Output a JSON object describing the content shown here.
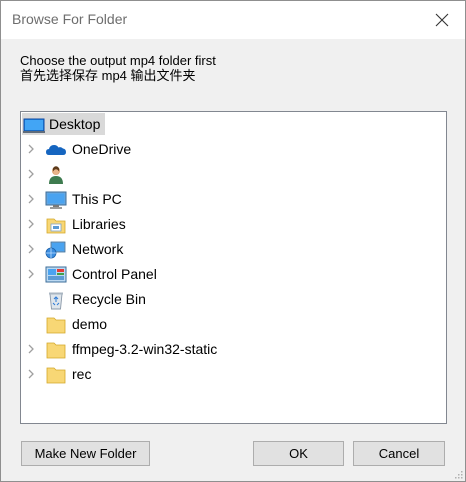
{
  "window": {
    "title": "Browse For Folder"
  },
  "instructions": {
    "line1": "Choose the output mp4 folder first",
    "line2": "首先选择保存 mp4 输出文件夹"
  },
  "tree": {
    "items": [
      {
        "label": "Desktop",
        "icon": "desktop-icon",
        "expandable": false,
        "selected": true
      },
      {
        "label": "OneDrive",
        "icon": "cloud-icon",
        "expandable": true
      },
      {
        "label": "",
        "icon": "user-icon",
        "expandable": true
      },
      {
        "label": "This PC",
        "icon": "computer-icon",
        "expandable": true
      },
      {
        "label": "Libraries",
        "icon": "libraries-icon",
        "expandable": true
      },
      {
        "label": "Network",
        "icon": "network-icon",
        "expandable": true
      },
      {
        "label": "Control Panel",
        "icon": "control-panel-icon",
        "expandable": true
      },
      {
        "label": "Recycle Bin",
        "icon": "recycle-bin-icon",
        "expandable": false
      },
      {
        "label": "demo",
        "icon": "folder-icon",
        "expandable": false
      },
      {
        "label": "ffmpeg-3.2-win32-static",
        "icon": "folder-icon",
        "expandable": true
      },
      {
        "label": "rec",
        "icon": "folder-icon",
        "expandable": true
      }
    ]
  },
  "buttons": {
    "new_folder": "Make New Folder",
    "ok": "OK",
    "cancel": "Cancel"
  },
  "colors": {
    "folder": "#f8d775",
    "selection": "#d9d9d9",
    "expander": "#a0a0a0"
  }
}
